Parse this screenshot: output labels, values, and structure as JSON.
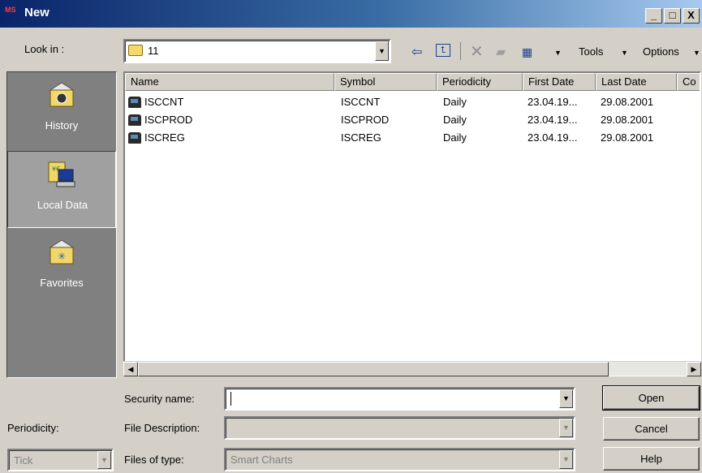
{
  "window": {
    "title": "New",
    "app_icon_text": "MS"
  },
  "titlebar_buttons": {
    "minimize": "_",
    "maximize": "□",
    "close": "X"
  },
  "toolbar": {
    "look_in_label": "Look in :",
    "look_in_value": "11",
    "tools_label": "Tools",
    "options_label": "Options"
  },
  "sidebar": {
    "items": [
      {
        "label": "History",
        "icon": "history-folder-icon"
      },
      {
        "label": "Local Data",
        "icon": "local-data-computer-icon"
      },
      {
        "label": "Favorites",
        "icon": "favorites-folder-icon"
      }
    ]
  },
  "filelist": {
    "columns": [
      "Name",
      "Symbol",
      "Periodicity",
      "First Date",
      "Last Date",
      "Co"
    ],
    "rows": [
      {
        "name": "ISCCNT",
        "symbol": "ISCCNT",
        "periodicity": "Daily",
        "first_date": "23.04.19...",
        "last_date": "29.08.2001"
      },
      {
        "name": "ISCPROD",
        "symbol": "ISCPROD",
        "periodicity": "Daily",
        "first_date": "23.04.19...",
        "last_date": "29.08.2001"
      },
      {
        "name": "ISCREG",
        "symbol": "ISCREG",
        "periodicity": "Daily",
        "first_date": "23.04.19...",
        "last_date": "29.08.2001"
      }
    ]
  },
  "form": {
    "security_name_label": "Security name:",
    "security_name_value": "",
    "file_description_label": "File Description:",
    "file_description_value": "",
    "files_of_type_label": "Files of type:",
    "files_of_type_value": "Smart Charts",
    "periodicity_label": "Periodicity:",
    "periodicity_value": "Tick"
  },
  "buttons": {
    "open": "Open",
    "cancel": "Cancel",
    "help": "Help"
  }
}
